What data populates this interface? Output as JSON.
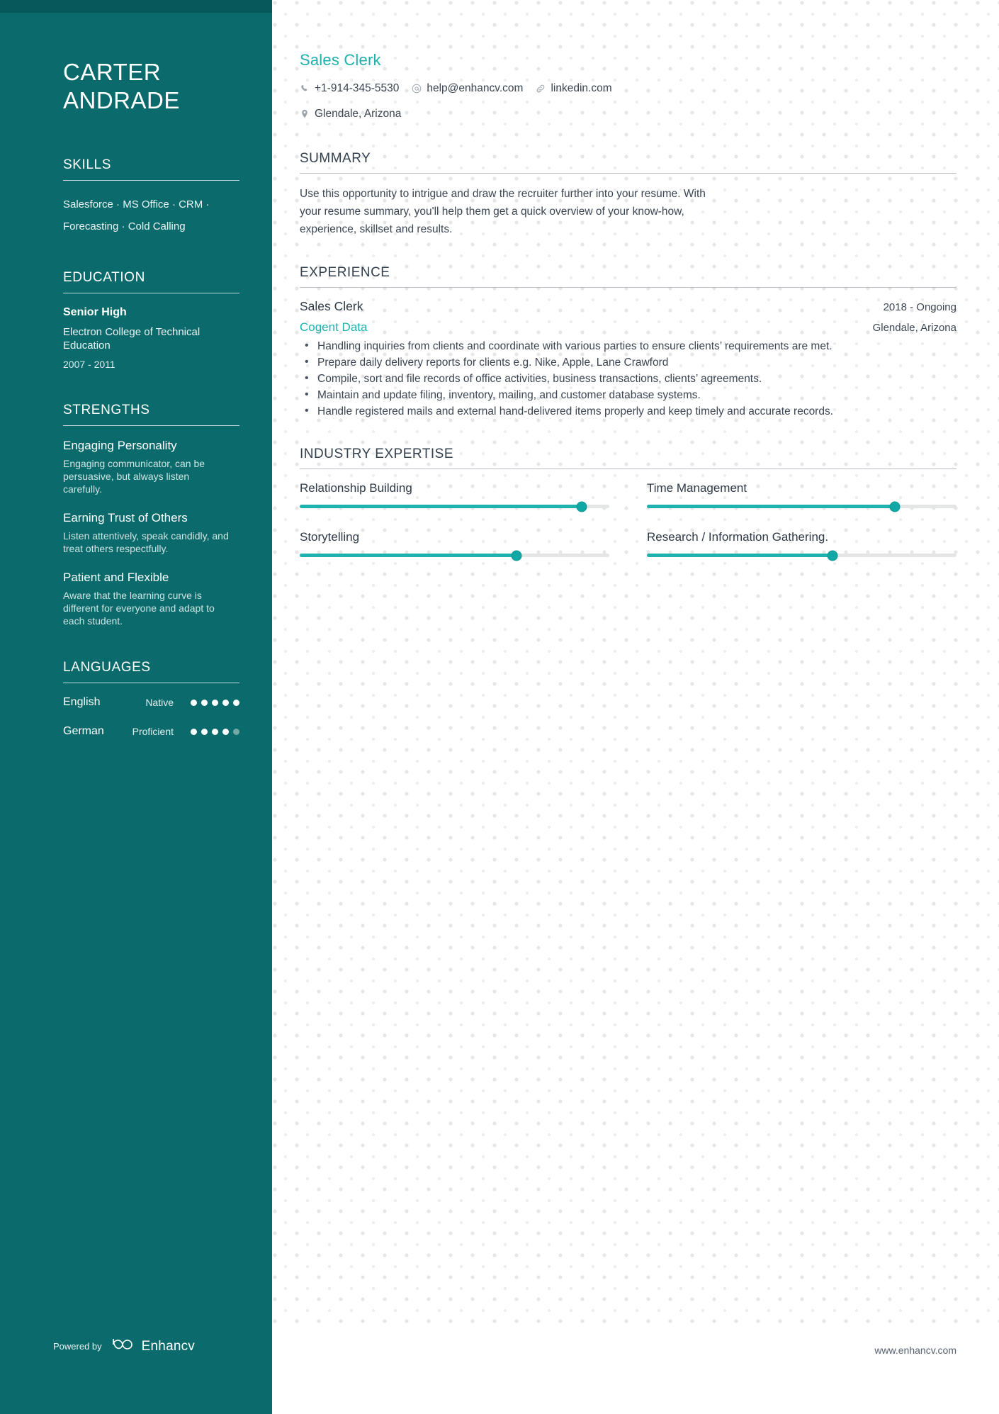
{
  "sidebar": {
    "name_lines": [
      "CARTER",
      "ANDRADE"
    ],
    "skills": {
      "heading": "SKILLS",
      "text": "Salesforce · MS Office · CRM · Forecasting · Cold Calling"
    },
    "education": {
      "heading": "EDUCATION",
      "entries": [
        {
          "degree": "Senior High",
          "school": "Electron College of Technical Education",
          "dates": "2007 - 2011"
        }
      ]
    },
    "strengths": {
      "heading": "STRENGTHS",
      "items": [
        {
          "title": "Engaging Personality",
          "description": "Engaging communicator, can be persuasive, but always listen carefully."
        },
        {
          "title": "Earning Trust of Others",
          "description": "Listen attentively, speak candidly, and treat others respectfully."
        },
        {
          "title": "Patient and Flexible",
          "description": "Aware that the learning curve is different for everyone and adapt to each student."
        }
      ]
    },
    "languages": {
      "heading": "LANGUAGES",
      "items": [
        {
          "name": "English",
          "level": "Native",
          "filled": 5,
          "total": 5
        },
        {
          "name": "German",
          "level": "Proficient",
          "filled": 4,
          "total": 5
        }
      ]
    },
    "footer": {
      "powered_by": "Powered by",
      "brand": "Enhancv"
    }
  },
  "main": {
    "job_title": "Sales Clerk",
    "contacts": [
      {
        "icon": "phone-icon",
        "value": "+1-914-345-5530"
      },
      {
        "icon": "email-icon",
        "value": "help@enhancv.com"
      },
      {
        "icon": "link-icon",
        "value": "linkedin.com"
      },
      {
        "icon": "location-icon",
        "value": "Glendale, Arizona"
      }
    ],
    "summary": {
      "heading": "SUMMARY",
      "text": "Use this opportunity to intrigue and draw the recruiter further into your resume. With your resume summary, you'll help them get a quick overview of your know-how, experience, skillset and results."
    },
    "experience": {
      "heading": "EXPERIENCE",
      "entries": [
        {
          "role": "Sales Clerk",
          "dates": "2018 - Ongoing",
          "company": "Cogent Data",
          "location": "Glendale, Arizona",
          "bullets": [
            "Handling inquiries from clients and coordinate with various parties to ensure clients’ requirements are met.",
            "Prepare daily delivery reports for clients e.g. Nike, Apple, Lane Crawford",
            "Compile, sort and file records of office activities, business transactions, clients’ agreements.",
            "Maintain and update filing, inventory, mailing, and customer database systems.",
            "Handle registered mails and external hand-delivered items properly and keep timely and accurate records."
          ]
        }
      ]
    },
    "industry_expertise": {
      "heading": "INDUSTRY EXPERTISE",
      "items": [
        {
          "label": "Relationship Building",
          "percent": 91
        },
        {
          "label": "Time Management",
          "percent": 80
        },
        {
          "label": "Storytelling",
          "percent": 70
        },
        {
          "label": "Research / Information Gathering.",
          "percent": 60
        }
      ]
    },
    "footer_url": "www.enhancv.com"
  },
  "colors": {
    "sidebar_bg": "#0B6A6B",
    "sidebar_topbar": "#06585A",
    "accent": "#1EB2AE",
    "text_dark": "#3c4653"
  }
}
